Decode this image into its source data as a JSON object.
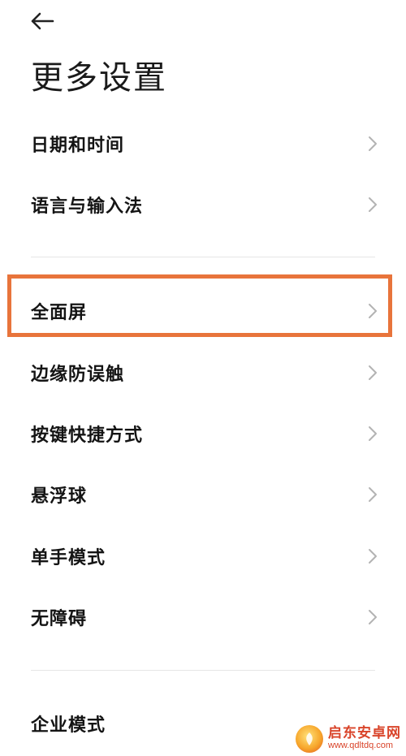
{
  "header": {
    "back_icon": "arrow-left-icon",
    "title": "更多设置"
  },
  "sections": [
    {
      "items": [
        {
          "label": "日期和时间",
          "icon": "chevron-right-icon"
        },
        {
          "label": "语言与输入法",
          "icon": "chevron-right-icon"
        }
      ]
    },
    {
      "items": [
        {
          "label": "全面屏",
          "icon": "chevron-right-icon",
          "highlighted": true
        },
        {
          "label": "边缘防误触",
          "icon": "chevron-right-icon"
        },
        {
          "label": "按键快捷方式",
          "icon": "chevron-right-icon"
        },
        {
          "label": "悬浮球",
          "icon": "chevron-right-icon"
        },
        {
          "label": "单手模式",
          "icon": "chevron-right-icon"
        },
        {
          "label": "无障碍",
          "icon": "chevron-right-icon"
        }
      ]
    },
    {
      "items": [
        {
          "label": "企业模式",
          "icon": "chevron-right-icon"
        }
      ]
    }
  ],
  "highlight_color": "#e8743b",
  "watermark": {
    "name": "启东安卓网",
    "url": "www.qdltdq.com"
  }
}
